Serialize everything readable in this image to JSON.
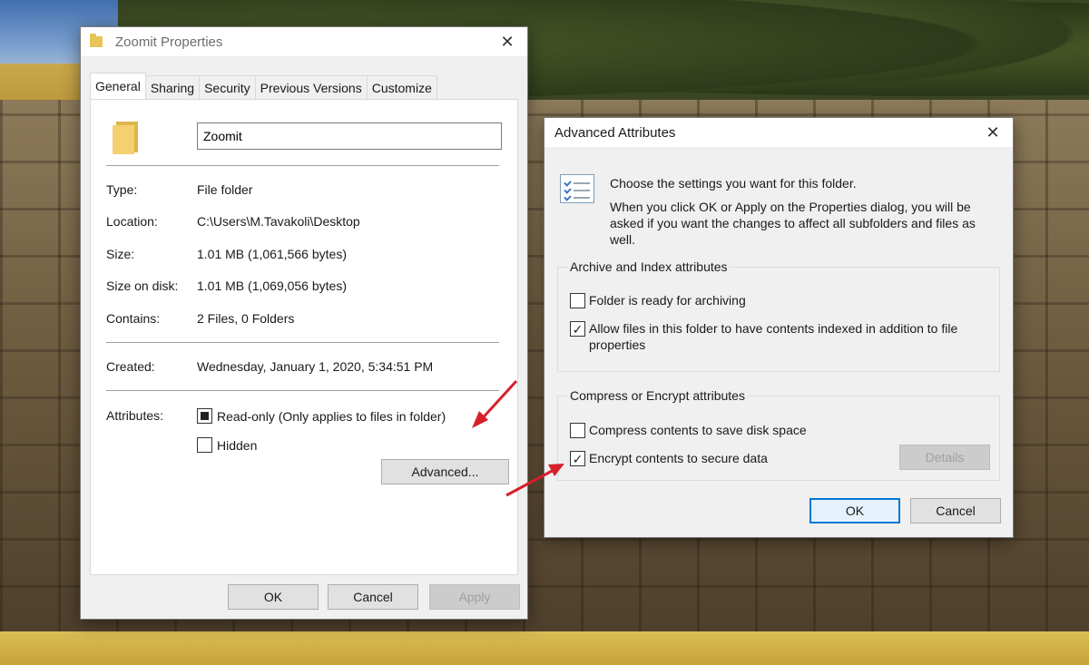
{
  "properties_window": {
    "title": "Zoomit Properties",
    "tabs": [
      {
        "label": "General",
        "active": true
      },
      {
        "label": "Sharing",
        "active": false
      },
      {
        "label": "Security",
        "active": false
      },
      {
        "label": "Previous Versions",
        "active": false
      },
      {
        "label": "Customize",
        "active": false
      }
    ],
    "folder_name": "Zoomit",
    "details": [
      {
        "label": "Type:",
        "value": "File folder"
      },
      {
        "label": "Location:",
        "value": "C:\\Users\\M.Tavakoli\\Desktop"
      },
      {
        "label": "Size:",
        "value": "1.01 MB (1,061,566 bytes)"
      },
      {
        "label": "Size on disk:",
        "value": "1.01 MB (1,069,056 bytes)"
      },
      {
        "label": "Contains:",
        "value": "2 Files, 0 Folders"
      }
    ],
    "created": {
      "label": "Created:",
      "value": "Wednesday, January 1, 2020, 5:34:51 PM"
    },
    "attributes": {
      "label": "Attributes:",
      "readonly_label": "Read-only (Only applies to files in folder)",
      "readonly_state": "indeterminate",
      "hidden_label": "Hidden",
      "hidden_checked": false,
      "advanced_button": "Advanced..."
    },
    "buttons": {
      "ok": "OK",
      "cancel": "Cancel",
      "apply": "Apply"
    }
  },
  "advanced_dialog": {
    "title": "Advanced Attributes",
    "intro_line1": "Choose the settings you want for this folder.",
    "intro_line2": "When you click OK or Apply on the Properties dialog, you will be asked if you want the changes to affect all subfolders and files as well.",
    "archive_group": {
      "title": "Archive and Index attributes",
      "archiving_label": "Folder is ready for archiving",
      "archiving_checked": false,
      "index_label": "Allow files in this folder to have contents indexed in addition to file properties",
      "index_checked": true
    },
    "compress_group": {
      "title": "Compress or Encrypt attributes",
      "compress_label": "Compress contents to save disk space",
      "compress_checked": false,
      "encrypt_label": "Encrypt contents to secure data",
      "encrypt_checked": true,
      "details_button": "Details"
    },
    "buttons": {
      "ok": "OK",
      "cancel": "Cancel"
    }
  },
  "colors": {
    "accent": "#0078d7",
    "annotation_arrow": "#d6202a",
    "window_bg": "#f0f0f0"
  },
  "icons": {
    "close": "close-icon",
    "folder": "folder-icon",
    "attributes_list": "checklist-icon"
  }
}
